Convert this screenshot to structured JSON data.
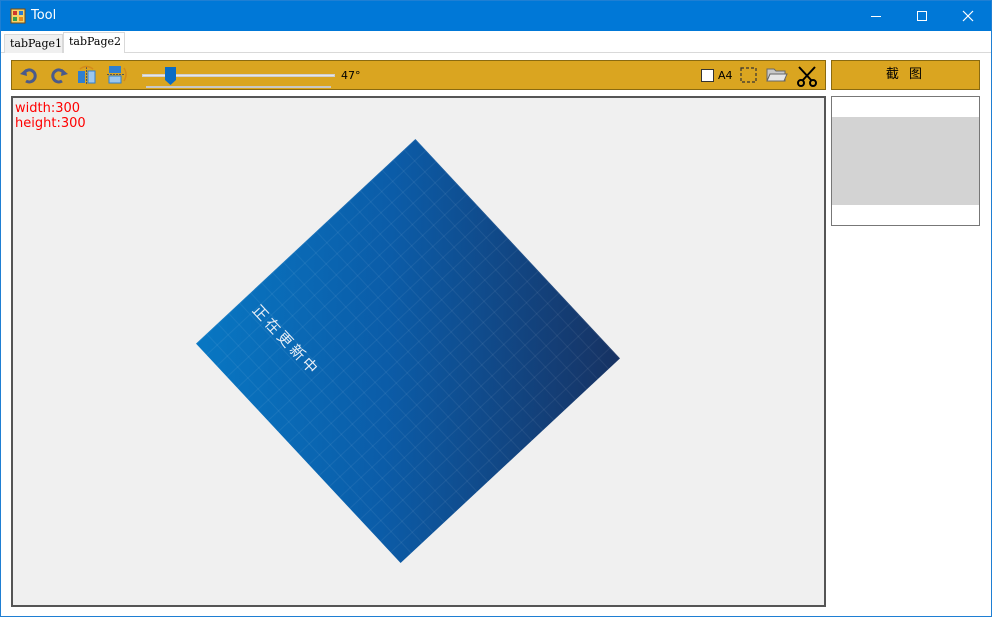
{
  "window": {
    "title": "Tool"
  },
  "tabs": [
    {
      "label": "tabPage1"
    },
    {
      "label": "tabPage2"
    }
  ],
  "toolbar": {
    "rotation_angle": "47°",
    "rotation_value_deg": 47,
    "a4_label": "A4",
    "a4_checked": false,
    "icons": [
      "rotate-left-icon",
      "rotate-right-icon",
      "flip-horizontal-icon",
      "flip-vertical-icon",
      "selection-icon",
      "folder-open-icon",
      "scissors-icon"
    ]
  },
  "capture_button": {
    "label": "截 图"
  },
  "canvas": {
    "width_text": "width:300",
    "height_text": "height:300",
    "image_text": "正在更新中",
    "text_color": "#ff0000"
  },
  "colors": {
    "toolbar_bg": "#daa520",
    "titlebar": "#0078d7",
    "gradient_start": "#0877c3",
    "gradient_end": "#173262"
  }
}
